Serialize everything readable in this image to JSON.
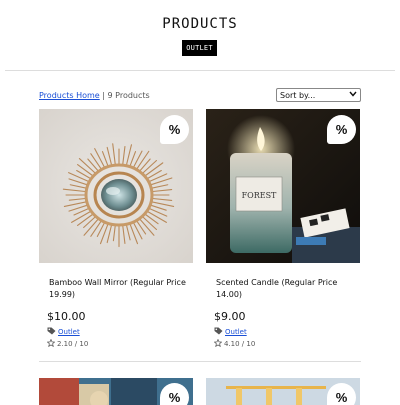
{
  "page_title": "PRODUCTS",
  "outlet_badge": "OUTLET",
  "breadcrumb": {
    "home_link": "Products Home",
    "separator": "|",
    "count": "9 Products"
  },
  "sort": {
    "selected": "Sort by..."
  },
  "products": [
    {
      "name": "Bamboo Wall Mirror (Regular Price 19.99)",
      "price": "$10.00",
      "category": "Outlet",
      "rating": "2.10 / 10",
      "discount_badge": "%"
    },
    {
      "name": "Scented Candle (Regular Price 14.00)",
      "price": "$9.00",
      "category": "Outlet",
      "rating": "4.10 / 10",
      "discount_badge": "%",
      "jar_label": "FOREST"
    }
  ],
  "next_row_badges": [
    "%",
    "%"
  ],
  "icons": {
    "category": "tag-icon",
    "rating": "star-outline-icon",
    "sort": "chevron-down-icon"
  },
  "colors": {
    "link": "#1a4fd6",
    "badge_bg": "#000000"
  }
}
